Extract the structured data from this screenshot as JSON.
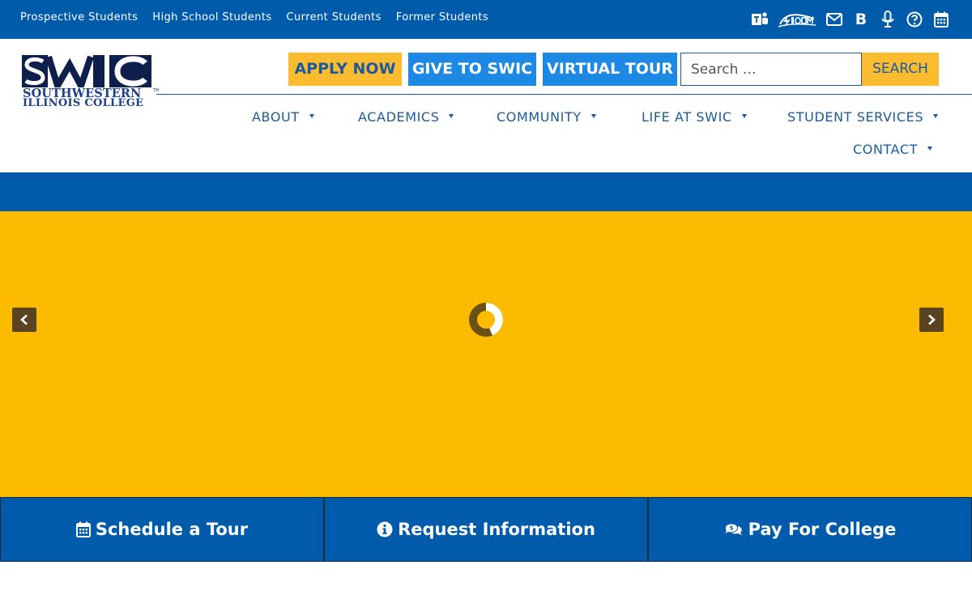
{
  "topbar": {
    "links": [
      "Prospective Students",
      "High School Students",
      "Current Students",
      "Former Students"
    ],
    "icons": [
      "teams-icon",
      "storm-icon",
      "email-icon",
      "blackboard-icon",
      "podcast-icon",
      "help-icon",
      "calendar-icon"
    ],
    "background": "#005bab"
  },
  "logo": {
    "mark": "SWIC",
    "line1": "SOUTHWESTERN",
    "line2": "ILLINOIS COLLEGE",
    "tm": "TM"
  },
  "header": {
    "apply_label": "APPLY NOW",
    "give_label": "GIVE TO SWIC",
    "tour_label": "VIRTUAL TOUR",
    "search_placeholder": "Search …",
    "search_button": "SEARCH"
  },
  "nav": {
    "items": [
      {
        "label": "ABOUT"
      },
      {
        "label": "ACADEMICS"
      },
      {
        "label": "COMMUNITY"
      },
      {
        "label": "LIFE AT SWIC"
      },
      {
        "label": "STUDENT SERVICES"
      },
      {
        "label": "CONTACT"
      }
    ]
  },
  "slider": {
    "background": "#fdbb00",
    "loading_icon": "spinner-icon"
  },
  "actions": [
    {
      "label": "Schedule a Tour",
      "icon": "calendar-icon"
    },
    {
      "label": "Request Information",
      "icon": "info-icon"
    },
    {
      "label": "Pay For College",
      "icon": "money-chat-icon"
    }
  ],
  "colors": {
    "brand_blue": "#005bab",
    "gold": "#fdbb30",
    "bright_blue": "#1e88e5",
    "nav_text": "#1b5b9d"
  }
}
